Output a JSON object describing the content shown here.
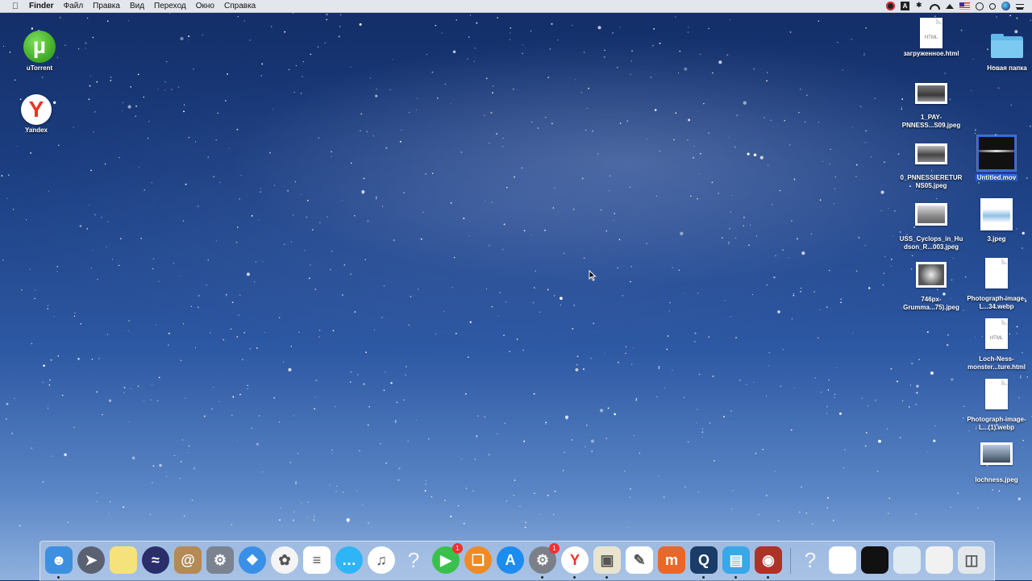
{
  "menubar": {
    "apple_icon": "apple-logo",
    "items": [
      "Finder",
      "Файл",
      "Правка",
      "Вид",
      "Переход",
      "Окно",
      "Справка"
    ],
    "tray_icons": [
      "screen-record-icon",
      "adobe-icon",
      "bluetooth-icon",
      "wifi-icon",
      "eject-icon",
      "us-flag-icon",
      "clock-icon",
      "spotlight-icon",
      "siri-icon",
      "notification-center-icon"
    ]
  },
  "desktop": {
    "left_icons": [
      {
        "label": "uTorrent",
        "icon": "utorrent-icon"
      },
      {
        "label": "Yandex",
        "icon": "yandex-browser-icon"
      }
    ],
    "right_icons": [
      {
        "label": "загруженное.html",
        "type": "html-doc",
        "doc_tag": "HTML"
      },
      {
        "label": "Новая папка",
        "type": "folder"
      },
      {
        "label": "1_PAY-PNNESS...S09.jpeg",
        "type": "image"
      },
      {
        "label": "0_PNNESSIERETURNS05.jpeg",
        "type": "image"
      },
      {
        "label": "Untitled.mov",
        "type": "movie",
        "selected": true
      },
      {
        "label": "USS_Cyclops_in_Hudson_R...003.jpeg",
        "type": "image"
      },
      {
        "label": "3.jpeg",
        "type": "image"
      },
      {
        "label": "746px-Grumma...75).jpeg",
        "type": "image"
      },
      {
        "label": "Photograph-image-L...34.webp",
        "type": "doc"
      },
      {
        "label": "Loch-Ness-monster...ture.html",
        "type": "html-doc",
        "doc_tag": "HTML"
      },
      {
        "label": "Photograph-image-L...(1).webp",
        "type": "doc"
      },
      {
        "label": "lochness.jpeg",
        "type": "image"
      }
    ]
  },
  "dock": {
    "items": [
      {
        "name": "finder",
        "icon": "finder-icon",
        "color": "#3d8fe0",
        "running": true
      },
      {
        "name": "launchpad",
        "icon": "launchpad-icon",
        "color": "#5a6170"
      },
      {
        "name": "notes",
        "icon": "notes-icon",
        "color": "#f6e27a"
      },
      {
        "name": "siri",
        "icon": "siri-icon",
        "color": "#2a2f6a"
      },
      {
        "name": "contacts",
        "icon": "contacts-icon",
        "color": "#b48a55"
      },
      {
        "name": "automator",
        "icon": "automator-icon",
        "color": "#7b8391"
      },
      {
        "name": "safari",
        "icon": "safari-icon",
        "color": "#3a8fe6"
      },
      {
        "name": "photos",
        "icon": "photos-icon",
        "color": "#f4f4f4"
      },
      {
        "name": "reminders",
        "icon": "reminders-icon",
        "color": "#ffffff"
      },
      {
        "name": "messages",
        "icon": "messages-icon",
        "color": "#2fb5f5"
      },
      {
        "name": "itunes",
        "icon": "itunes-icon",
        "color": "#ffffff"
      },
      {
        "name": "unknown",
        "icon": "question-icon",
        "color": "rgba(0,0,0,0)"
      },
      {
        "name": "facetime",
        "icon": "facetime-icon",
        "color": "#3ac14b",
        "badge": "1"
      },
      {
        "name": "ibooks",
        "icon": "ibooks-icon",
        "color": "#f08a24"
      },
      {
        "name": "app-store",
        "icon": "app-store-icon",
        "color": "#1d8cf0"
      },
      {
        "name": "system-preferences",
        "icon": "system-preferences-icon",
        "color": "#7b7f88",
        "badge": "1",
        "running": true
      },
      {
        "name": "yandex-browser",
        "icon": "yandex-browser-icon",
        "color": "#ffffff",
        "running": true
      },
      {
        "name": "preview",
        "icon": "preview-icon",
        "color": "#e9e4cf",
        "running": true
      },
      {
        "name": "textedit",
        "icon": "textedit-icon",
        "color": "#ffffff"
      },
      {
        "name": "mosaic",
        "icon": "m-app-icon",
        "color": "#e8682b"
      },
      {
        "name": "quicktime",
        "icon": "quicktime-icon",
        "color": "#1b3c66",
        "running": true
      },
      {
        "name": "airplay",
        "icon": "airplay-icon",
        "color": "#39a7e8",
        "running": true
      },
      {
        "name": "photo-booth",
        "icon": "photo-booth-icon",
        "color": "#b0302a",
        "running": true
      },
      {
        "name": "unknown-2",
        "icon": "question-icon",
        "color": "rgba(0,0,0,0)"
      },
      {
        "name": "stack-yandex",
        "icon": "document-stack-icon",
        "color": "#ffffff"
      },
      {
        "name": "stack-dark",
        "icon": "image-stack-icon",
        "color": "#111111"
      },
      {
        "name": "stack-map",
        "icon": "map-stack-icon",
        "color": "#dfeaf3"
      },
      {
        "name": "stack-downloads",
        "icon": "downloads-stack-icon",
        "color": "#f1f1f1"
      },
      {
        "name": "trash",
        "icon": "trash-icon",
        "color": "#e4e8ec"
      }
    ]
  }
}
